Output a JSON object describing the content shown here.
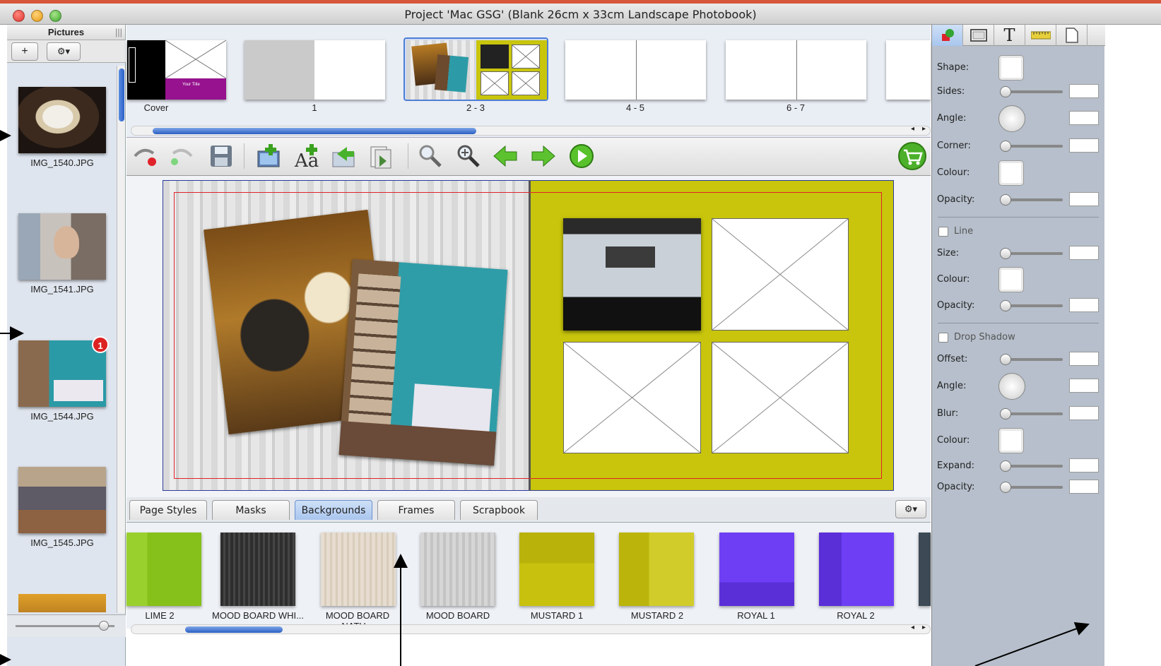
{
  "window": {
    "title": "Project 'Mac GSG' (Blank 26cm x 33cm Landscape Photobook)"
  },
  "pictures_pane": {
    "header": "Pictures",
    "add_label": "+",
    "gear_label": "⚙▾",
    "items": [
      {
        "filename": "IMG_1540.JPG",
        "badge": ""
      },
      {
        "filename": "IMG_1541.JPG",
        "badge": ""
      },
      {
        "filename": "IMG_1544.JPG",
        "badge": "1"
      },
      {
        "filename": "IMG_1545.JPG",
        "badge": ""
      }
    ]
  },
  "page_strip": {
    "spreads": [
      {
        "label": "Cover",
        "selected": false
      },
      {
        "label": "1",
        "selected": false
      },
      {
        "label": "2 - 3",
        "selected": true
      },
      {
        "label": "4 - 5",
        "selected": false
      },
      {
        "label": "6 - 7",
        "selected": false
      }
    ],
    "cover_text": "Your Title"
  },
  "toolbar": {
    "items": [
      "undo",
      "redo",
      "save",
      "add-picture",
      "add-text",
      "import",
      "export",
      "zoom-out",
      "zoom-in",
      "previous-page",
      "next-page",
      "preview",
      "cart"
    ]
  },
  "bottom_tabs": {
    "tabs": [
      "Page Styles",
      "Masks",
      "Backgrounds",
      "Frames",
      "Scrapbook"
    ],
    "active": "Backgrounds",
    "gear_label": "⚙▾"
  },
  "backgrounds": [
    {
      "label": "LIME 2",
      "color": "#86c01a"
    },
    {
      "label": "MOOD BOARD WHI...",
      "color": "#3a3a3a"
    },
    {
      "label": "MOOD BOARD NATU...",
      "color": "#e2d8cb"
    },
    {
      "label": "MOOD BOARD",
      "color": "#cfcfcf"
    },
    {
      "label": "MUSTARD 1",
      "color": "#c8c20f"
    },
    {
      "label": "MUSTARD 2",
      "color": "#c8c20f"
    },
    {
      "label": "ROYAL 1",
      "color": "#6e3ef5"
    },
    {
      "label": "ROYAL 2",
      "color": "#6e3ef5"
    }
  ],
  "inspector": {
    "tabs": [
      "shape-tab",
      "frame-tab",
      "text-tab",
      "ruler-tab",
      "page-tab"
    ],
    "shape_rows": [
      {
        "label": "Shape:",
        "kind": "well"
      },
      {
        "label": "Sides:",
        "kind": "slider"
      },
      {
        "label": "Angle:",
        "kind": "dial"
      },
      {
        "label": "Corner:",
        "kind": "slider"
      },
      {
        "label": "Colour:",
        "kind": "well"
      },
      {
        "label": "Opacity:",
        "kind": "slider"
      }
    ],
    "line_checkbox": "Line",
    "line_rows": [
      {
        "label": "Size:",
        "kind": "slider"
      },
      {
        "label": "Colour:",
        "kind": "well"
      },
      {
        "label": "Opacity:",
        "kind": "slider"
      }
    ],
    "shadow_checkbox": "Drop Shadow",
    "shadow_rows": [
      {
        "label": "Offset:",
        "kind": "slider"
      },
      {
        "label": "Angle:",
        "kind": "dial"
      },
      {
        "label": "Blur:",
        "kind": "slider"
      },
      {
        "label": "Colour:",
        "kind": "well"
      },
      {
        "label": "Expand:",
        "kind": "slider"
      },
      {
        "label": "Opacity:",
        "kind": "slider"
      }
    ]
  },
  "colors": {
    "accent_blue": "#2c60c8",
    "mustard": "#c8c50c",
    "guide_red": "#e0232a"
  }
}
